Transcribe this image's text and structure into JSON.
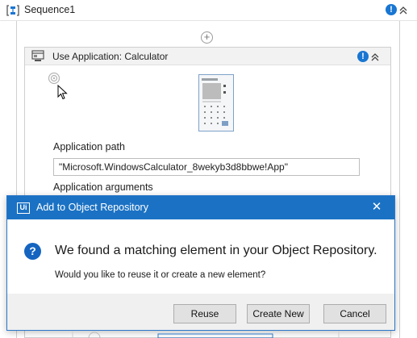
{
  "sequence": {
    "title": "Sequence1",
    "icon": "sequence-icon",
    "warning_icon": "info-badge-icon",
    "collapse_icon": "double-chevron-up-icon"
  },
  "add_activity": {
    "icon": "plus-circle-icon"
  },
  "activity": {
    "title": "Use Application: Calculator",
    "icon": "use-application-icon",
    "warning_icon": "info-badge-icon",
    "collapse_icon": "double-chevron-up-icon",
    "target_icon": "target-icon",
    "screenshot_icon": "calculator-screenshot"
  },
  "fields": {
    "app_path_label": "Application path",
    "app_path_value": "\"Microsoft.WindowsCalculator_8wekyb3d8bbwe!App\"",
    "app_args_label": "Application arguments"
  },
  "dialog": {
    "title": "Add to Object Repository",
    "heading": "We found a matching element in your Object Repository.",
    "subtext": "Would you like to reuse it or create a new element?",
    "buttons": {
      "reuse": "Reuse",
      "create_new": "Create New",
      "cancel": "Cancel"
    },
    "colors": {
      "titlebar": "#1b72c4",
      "question_icon": "#1565c0"
    }
  },
  "colors": {
    "info_badge": "#1976d2",
    "dialog_border": "#2a77c9"
  }
}
